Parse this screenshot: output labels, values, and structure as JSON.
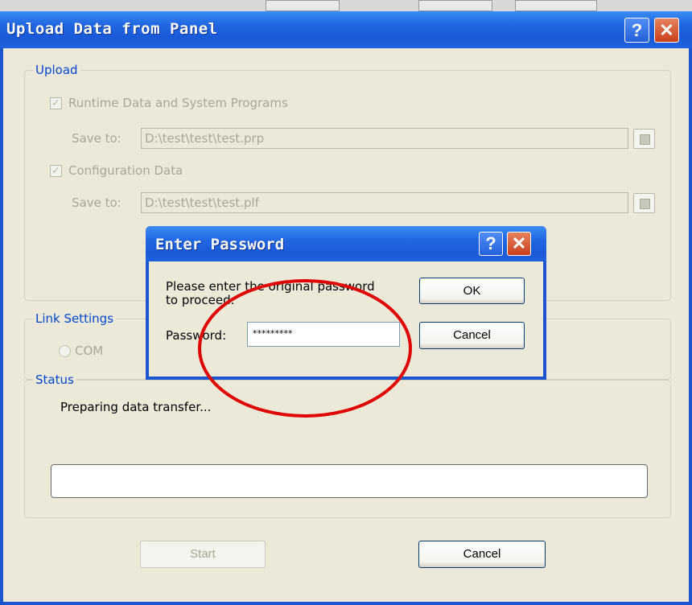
{
  "window": {
    "title": "Upload Data from Panel",
    "help_label": "?",
    "close_label": "✕"
  },
  "upload_group": {
    "label": "Upload",
    "runtime": {
      "label": "Runtime Data and System Programs",
      "checked": true,
      "save_label": "Save to:",
      "path": "D:\\test\\test\\test.prp"
    },
    "config": {
      "label": "Configuration Data",
      "checked": true,
      "save_label": "Save to:",
      "path": "D:\\test\\test\\test.plf"
    }
  },
  "link_group": {
    "label": "Link Settings",
    "com_label": "COM"
  },
  "status_group": {
    "label": "Status",
    "message": "Preparing data transfer...",
    "progress": 0
  },
  "footer": {
    "start_label": "Start",
    "cancel_label": "Cancel"
  },
  "password_dialog": {
    "title": "Enter Password",
    "help_label": "?",
    "close_label": "✕",
    "prompt_line1": "Please enter the original password",
    "prompt_line2": "to proceed.",
    "password_label": "Password:",
    "password_value": "*********",
    "ok_label": "OK",
    "cancel_label": "Cancel"
  },
  "colors": {
    "titlebar_blue": "#2167e2",
    "group_label_blue": "#0046d5",
    "face": "#ece9d8",
    "annotation_red": "#e00000"
  },
  "checkmark": "✓"
}
